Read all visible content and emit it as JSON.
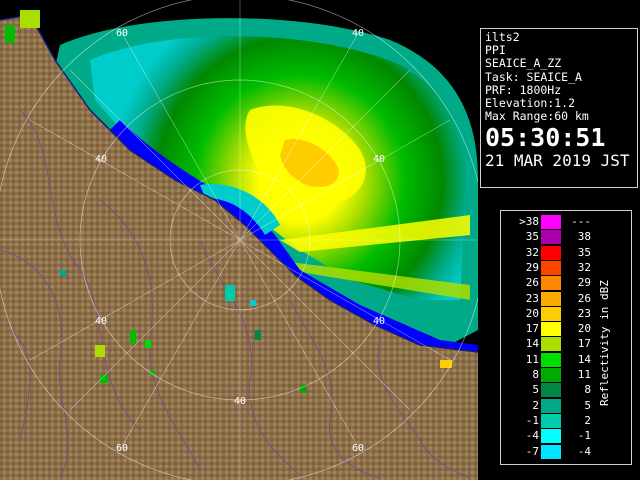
{
  "info": {
    "site": "ilts2",
    "scan_type": "PPI",
    "product": "SEAICE_A_ZZ",
    "task": "Task: SEAICE_A",
    "prf": "PRF: 1800Hz",
    "elevation": "Elevation:1.2",
    "max_range": "Max Range:60 km",
    "time": "05:30:51",
    "date": "21 MAR 2019 JST"
  },
  "range_labels": {
    "top_60": "60",
    "top_40": "40",
    "left_40": "40",
    "ne_40": "40",
    "right_40": "40",
    "sw_40": "40",
    "bottom_40": "40",
    "bottom_60_left": "60",
    "bottom_60_right": "60"
  },
  "legend": {
    "unit": "Reflectivity in dBZ",
    "rows": [
      {
        "min": ">38",
        "max": "---",
        "color": "#ff00ff"
      },
      {
        "min": "35",
        "max": "38",
        "color": "#aa00aa"
      },
      {
        "min": "32",
        "max": "35",
        "color": "#ff0000"
      },
      {
        "min": "29",
        "max": "32",
        "color": "#ff4400"
      },
      {
        "min": "26",
        "max": "29",
        "color": "#ff8800"
      },
      {
        "min": "23",
        "max": "26",
        "color": "#ffaa00"
      },
      {
        "min": "20",
        "max": "23",
        "color": "#ffcc00"
      },
      {
        "min": "17",
        "max": "20",
        "color": "#ffff00"
      },
      {
        "min": "14",
        "max": "17",
        "color": "#aadd00"
      },
      {
        "min": "11",
        "max": "14",
        "color": "#00dd00"
      },
      {
        "min": "8",
        "max": "11",
        "color": "#00aa00"
      },
      {
        "min": "5",
        "max": "8",
        "color": "#008844"
      },
      {
        "min": "2",
        "max": "5",
        "color": "#00aa88"
      },
      {
        "min": "-1",
        "max": "2",
        "color": "#00ccaa"
      },
      {
        "min": "-4",
        "max": "-1",
        "color": "#00ffff"
      },
      {
        "min": "-7",
        "max": "-4",
        "color": "#00e5ff"
      }
    ]
  },
  "colors": {
    "background": "#000000",
    "land": "#8c6e48",
    "sea": "#0000ff",
    "ring": "#ffffff",
    "coastline": "#1a1a7a",
    "rivers": "#7a4a8a"
  }
}
